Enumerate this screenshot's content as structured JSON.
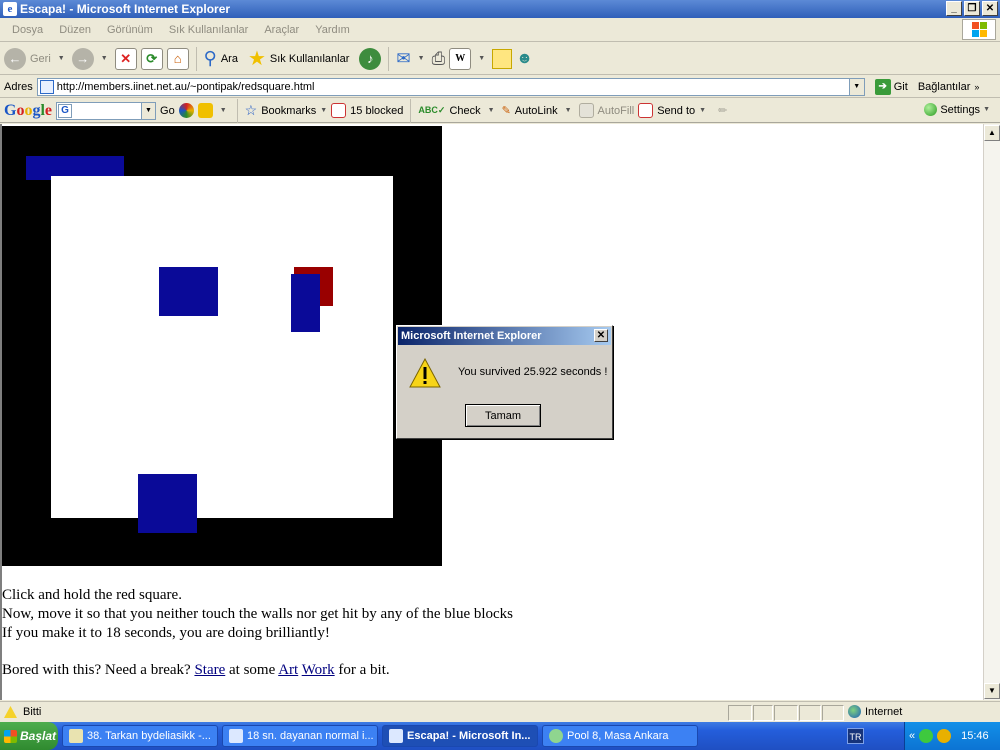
{
  "window": {
    "title": "Escapa! - Microsoft Internet Explorer"
  },
  "menu": [
    "Dosya",
    "Düzen",
    "Görünüm",
    "Sık Kullanılanlar",
    "Araçlar",
    "Yardım"
  ],
  "toolbar": {
    "back_label": "Geri",
    "search_label": "Ara",
    "favorites_label": "Sık Kullanılanlar"
  },
  "address": {
    "label": "Adres",
    "url": "http://members.iinet.net.au/~pontipak/redsquare.html",
    "go_label": "Git",
    "links_label": "Bağlantılar"
  },
  "google_bar": {
    "logo": "Google",
    "go_label": "Go",
    "bookmarks_label": "Bookmarks",
    "blocked_label": "15 blocked",
    "check_label": "Check",
    "autolink_label": "AutoLink",
    "autofill_label": "AutoFill",
    "sendto_label": "Send to",
    "settings_label": "Settings"
  },
  "page": {
    "line1": "Click and hold the red square.",
    "line2": "Now, move it so that you neither touch the walls nor get hit by any of the blue blocks",
    "line3": "If you make it to 18 seconds, you are doing brilliantly!",
    "line4_prefix": "Bored with this? Need a break?",
    "link_stare": "Stare",
    "line4_mid": "at some",
    "link_art": "Art",
    "link_work": "Work",
    "line4_suffix": "for a bit."
  },
  "dialog": {
    "title": "Microsoft Internet Explorer",
    "message": "You survived 25.922 seconds !",
    "ok_label": "Tamam"
  },
  "status": {
    "text": "Bitti",
    "zone": "Internet"
  },
  "taskbar": {
    "start_label": "Başlat",
    "tasks": [
      "38. Tarkan bydeliasikk -...",
      "18 sn. dayanan normal i...",
      "Escapa! - Microsoft In...",
      "Pool 8, Masa Ankara"
    ],
    "lang": "TR",
    "tray_chevron": "«",
    "clock": "15:46"
  },
  "colors": {
    "blue_block": "#0a0a98",
    "red_square": "#990000",
    "board": "#000000"
  }
}
